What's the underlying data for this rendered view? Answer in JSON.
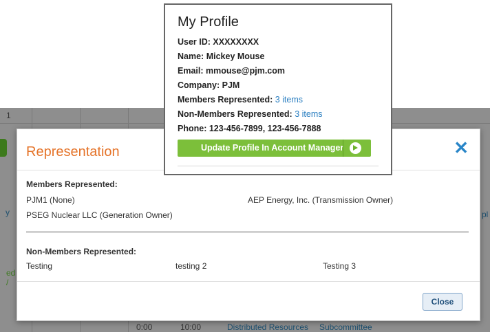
{
  "background": {
    "header_number": "1",
    "link_label_left": "y",
    "side_text_1": "ed",
    "side_text_2": "/",
    "right_fragment": "pl",
    "bottom_row": {
      "time_1": "0:00",
      "time_2": "10:00",
      "link_1": "Distributed Resources",
      "link_2": "Subcommittee"
    }
  },
  "modal": {
    "title": "Representation",
    "close_icon": "close-x-icon",
    "members_heading": "Members Represented:",
    "members": [
      "PJM1 (None)",
      "AEP Energy, Inc. (Transmission Owner)",
      "PSEG Nuclear LLC (Generation Owner)"
    ],
    "non_members_heading": "Non-Members Represented:",
    "non_members": [
      "Testing",
      "testing 2",
      "Testing 3"
    ],
    "close_button": "Close"
  },
  "profile": {
    "title": "My Profile",
    "user_id_label": "User ID:",
    "user_id": "XXXXXXXX",
    "name_label": "Name:",
    "name": "Mickey Mouse",
    "email_label": "Email:",
    "email": "mmouse@pjm.com",
    "company_label": "Company:",
    "company": "PJM",
    "members_label": "Members Represented:",
    "members_link": "3 items",
    "non_members_label": "Non-Members Represented:",
    "non_members_link": "3 items",
    "phone_label": "Phone:",
    "phone": "123-456-7899, 123-456-7888",
    "update_button": "Update Profile In Account Manager",
    "update_icon": "arrow-circle-right-icon",
    "accent_color": "#7cbf3a"
  }
}
